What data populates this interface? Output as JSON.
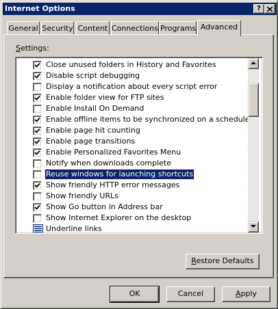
{
  "window": {
    "title": "Internet Options",
    "help_button": "?",
    "close_button": "X"
  },
  "tabs": [
    {
      "label": "General",
      "active": false
    },
    {
      "label": "Security",
      "active": false
    },
    {
      "label": "Content",
      "active": false
    },
    {
      "label": "Connections",
      "active": false
    },
    {
      "label": "Programs",
      "active": false
    },
    {
      "label": "Advanced",
      "active": true
    }
  ],
  "settings": {
    "label_prefix": "S",
    "label_rest": "ettings:",
    "items": [
      {
        "label": "Close unused folders in History and Favorites",
        "checked": true
      },
      {
        "label": "Disable script debugging",
        "checked": true
      },
      {
        "label": "Display a notification about every script error",
        "checked": false
      },
      {
        "label": "Enable folder view for FTP sites",
        "checked": true
      },
      {
        "label": "Enable Install On Demand",
        "checked": false
      },
      {
        "label": "Enable offline items to be synchronized on a schedule",
        "checked": true
      },
      {
        "label": "Enable page hit counting",
        "checked": true
      },
      {
        "label": "Enable page transitions",
        "checked": true
      },
      {
        "label": "Enable Personalized Favorites Menu",
        "checked": true
      },
      {
        "label": "Notify when downloads complete",
        "checked": false
      },
      {
        "label": "Reuse windows for launching shortcuts",
        "checked": false,
        "selected": true
      },
      {
        "label": "Show friendly HTTP error messages",
        "checked": true
      },
      {
        "label": "Show friendly URLs",
        "checked": false
      },
      {
        "label": "Show Go button in Address bar",
        "checked": true
      },
      {
        "label": "Show Internet Explorer on the desktop",
        "checked": false
      },
      {
        "label": "Underline links",
        "type": "group",
        "icon": "list-group-icon"
      }
    ]
  },
  "buttons": {
    "restore_defaults_prefix": "R",
    "restore_defaults_rest": "estore Defaults",
    "ok": "OK",
    "cancel": "Cancel",
    "apply_prefix": "A",
    "apply_rest": "pply"
  },
  "colors": {
    "titlebar": "#0a246a",
    "face": "#d4d0c8",
    "selection": "#0a246a"
  }
}
